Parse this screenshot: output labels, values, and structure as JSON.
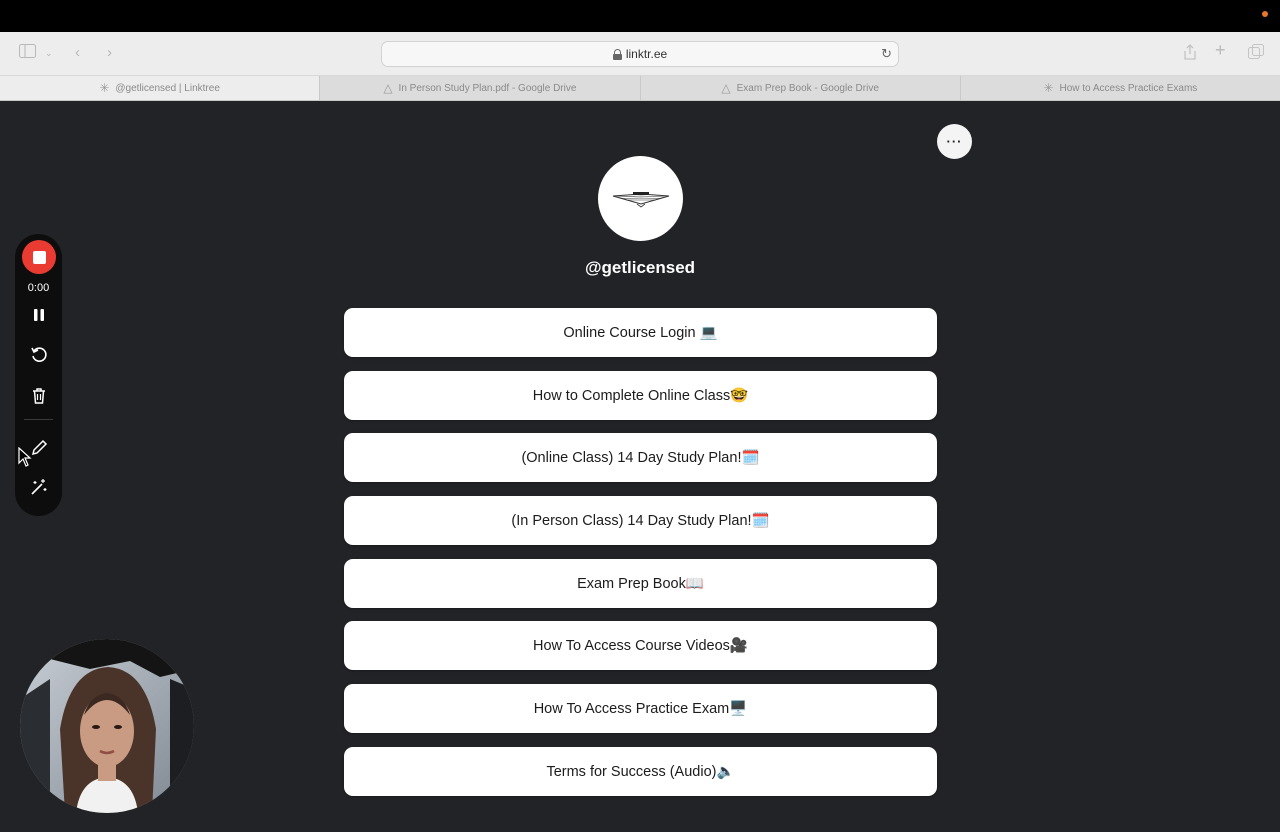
{
  "browser": {
    "url": "linktr.ee",
    "tabs": [
      {
        "label": "@getlicensed | Linktree",
        "icon": "linktree-icon",
        "active": true
      },
      {
        "label": "In Person Study Plan.pdf - Google Drive",
        "icon": "google-drive-icon",
        "active": false
      },
      {
        "label": "Exam Prep Book - Google Drive",
        "icon": "google-drive-icon",
        "active": false
      },
      {
        "label": "How to Access Practice Exams",
        "icon": "linktree-icon",
        "active": false
      }
    ]
  },
  "profile": {
    "username": "@getlicensed"
  },
  "links": [
    "Online Course Login 💻",
    "How to Complete Online Class🤓",
    "(Online Class) 14 Day Study Plan!🗓️",
    "(In Person Class) 14 Day Study Plan!🗓️",
    "Exam Prep Book📖",
    "How To Access Course Videos🎥",
    "How To Access Practice Exam🖥️",
    "Terms for Success (Audio)🔈"
  ],
  "recorder": {
    "timer": "0:00",
    "accent": "#ea3b33"
  },
  "colors": {
    "page_bg": "#212327",
    "button_bg": "#ffffff"
  }
}
